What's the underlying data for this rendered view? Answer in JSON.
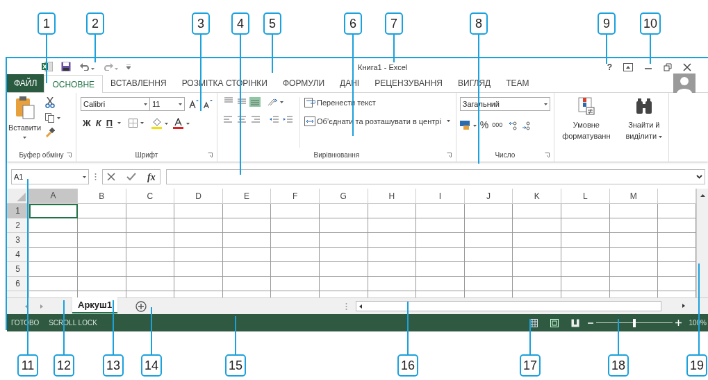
{
  "callouts": [
    "1",
    "2",
    "3",
    "4",
    "5",
    "6",
    "7",
    "8",
    "9",
    "10",
    "11",
    "12",
    "13",
    "14",
    "15",
    "16",
    "17",
    "18",
    "19"
  ],
  "window": {
    "title": "Книга1 - Excel",
    "help": "?"
  },
  "ribbon_tabs": [
    {
      "label": "ФАЙЛ",
      "kind": "file",
      "selected": false
    },
    {
      "label": "ОСНОВНЕ",
      "kind": "tab",
      "selected": true
    },
    {
      "label": "ВСТАВЛЕННЯ",
      "kind": "tab",
      "selected": false
    },
    {
      "label": "РОЗМІТКА СТОРІНКИ",
      "kind": "tab",
      "selected": false
    },
    {
      "label": "ФОРМУЛИ",
      "kind": "tab",
      "selected": false
    },
    {
      "label": "ДАНІ",
      "kind": "tab",
      "selected": false
    },
    {
      "label": "РЕЦЕНЗУВАННЯ",
      "kind": "tab",
      "selected": false
    },
    {
      "label": "ВИГЛЯД",
      "kind": "tab",
      "selected": false
    },
    {
      "label": "TEAM",
      "kind": "tab",
      "selected": false
    }
  ],
  "clipboard": {
    "paste": "Вставити",
    "group": "Буфер обміну"
  },
  "font": {
    "name": "Calibri",
    "size": "11",
    "bold": "Ж",
    "italic": "К",
    "underline": "П",
    "group": "Шрифт"
  },
  "alignment": {
    "wrap": "Перенести текст",
    "merge": "Об’єднати та розташувати в центрі",
    "group": "Вирівнювання"
  },
  "number": {
    "format": "Загальний",
    "percent": "%",
    "thousands": "000",
    "group": "Число"
  },
  "styles": {
    "conditional": "Умовне форматуванн",
    "find": "Знайти й виділити"
  },
  "formula_bar": {
    "name_box": "A1",
    "fx": "fx"
  },
  "sheet": {
    "columns": [
      "A",
      "B",
      "C",
      "D",
      "E",
      "F",
      "G",
      "H",
      "I",
      "J",
      "K",
      "L",
      "M"
    ],
    "rows": [
      "1",
      "2",
      "3",
      "4",
      "5",
      "6"
    ]
  },
  "sheet_tabs": [
    {
      "label": "Аркуш1",
      "selected": true
    }
  ],
  "status_bar": {
    "items": [
      "ГОТОВО",
      "SCROLL LOCK"
    ],
    "zoom": "100%",
    "zoom_level": {
      "level": 0.5
    }
  }
}
